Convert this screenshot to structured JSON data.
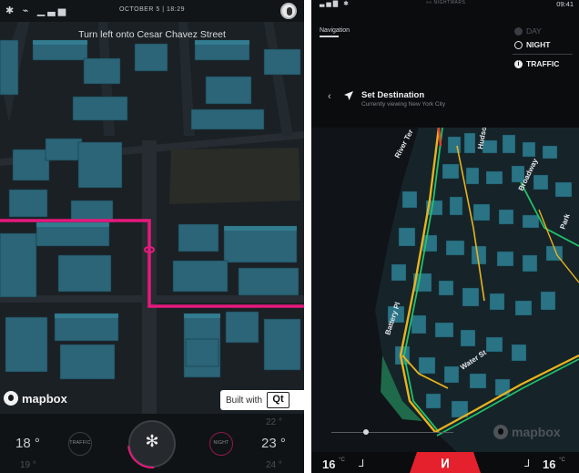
{
  "left_screen": {
    "status": {
      "icons": "✱ ⌁ ▁▃▅",
      "date_time": "OCTOBER 5 | 18:29"
    },
    "instruction": "Turn left onto Cesar Chavez Street",
    "brand": "mapbox",
    "built_with": {
      "text": "Built with",
      "qt": "Qt"
    },
    "climate": {
      "left_temp": "18 °",
      "right_temp": "23 °",
      "ghost_left_below": "19 °",
      "ghost_right_above": "22 °",
      "ghost_right_below": "24 °",
      "traffic_button": "TRAFFIC",
      "night_button": "NIGHT",
      "fan_icon": "fan-icon"
    },
    "colors": {
      "route": "#e5197c",
      "building": "#2a5e70"
    }
  },
  "right_screen": {
    "status": {
      "signal": "▃▅▇ ✱",
      "logo": "»« NIGHTWARS",
      "time": "09:41"
    },
    "tab": "Navigation",
    "modes": [
      {
        "label": "DAY",
        "selected": false
      },
      {
        "label": "NIGHT",
        "selected": true
      },
      {
        "label": "TRAFFIC",
        "selected": true
      }
    ],
    "destination": {
      "back": "‹",
      "title": "Set Destination",
      "subtitle": "Currently viewing New York City"
    },
    "street_labels": [
      "Hudson",
      "River Ter",
      "Broadway",
      "Park",
      "Battery Pl",
      "Water St"
    ],
    "brand": "mapbox",
    "bottom": {
      "left_temp": "16",
      "right_temp": "16",
      "unit": "°C"
    },
    "colors": {
      "traffic_green": "#21c36a",
      "traffic_yellow": "#e8b41e",
      "traffic_red": "#e63a2b",
      "home": "#e4212c"
    }
  }
}
